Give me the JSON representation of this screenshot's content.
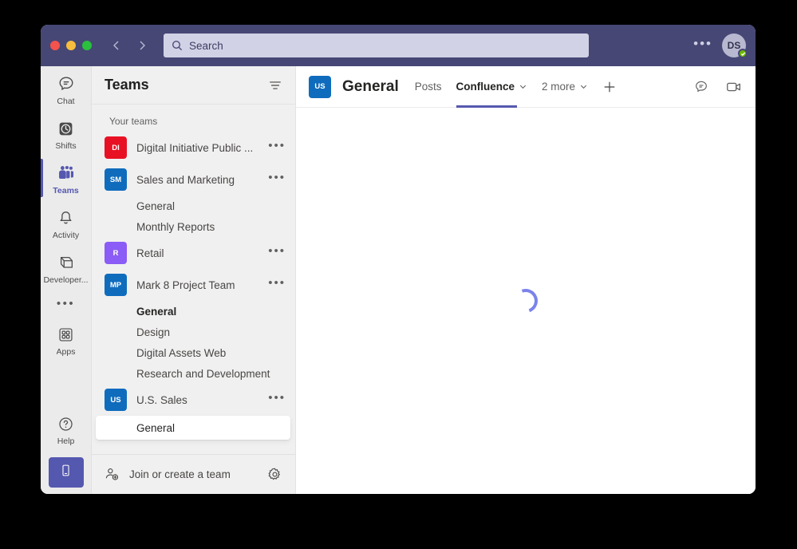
{
  "window": {
    "traffic_lights": [
      "close",
      "minimize",
      "maximize"
    ]
  },
  "titlebar": {
    "back_icon": "chevron-left-icon",
    "forward_icon": "chevron-right-icon",
    "search": {
      "icon": "search-icon",
      "placeholder": "Search",
      "value": ""
    },
    "overflow_label": "•••",
    "avatar": {
      "initials": "DS",
      "presence": "available"
    }
  },
  "rail": {
    "items": [
      {
        "label": "Chat",
        "icon": "chat-icon",
        "active": false
      },
      {
        "label": "Shifts",
        "icon": "shifts-icon",
        "active": false
      },
      {
        "label": "Teams",
        "icon": "teams-icon",
        "active": true
      },
      {
        "label": "Activity",
        "icon": "activity-bell-icon",
        "active": false
      },
      {
        "label": "Developer...",
        "icon": "developer-icon",
        "active": false
      }
    ],
    "more_label": "•••",
    "apps": {
      "label": "Apps",
      "icon": "apps-grid-icon"
    },
    "help": {
      "label": "Help",
      "icon": "help-question-icon"
    },
    "mobile_button": {
      "icon": "mobile-phone-icon"
    }
  },
  "teams_panel": {
    "title": "Teams",
    "filter_icon": "filter-icon",
    "section_label": "Your teams",
    "teams": [
      {
        "name": "Digital Initiative Public ...",
        "initials": "DI",
        "color": "#e81123",
        "menu": "•••",
        "channels": []
      },
      {
        "name": "Sales and Marketing",
        "initials": "SM",
        "color": "#0f6cbd",
        "menu": "•••",
        "channels": [
          {
            "name": "General",
            "bold": false,
            "selected": false
          },
          {
            "name": "Monthly Reports",
            "bold": false,
            "selected": false
          }
        ]
      },
      {
        "name": "Retail",
        "initials": "R",
        "color": "#8b5cf6",
        "menu": "•••",
        "channels": []
      },
      {
        "name": "Mark 8 Project Team",
        "initials": "MP",
        "color": "#0f6cbd",
        "menu": "•••",
        "channels": [
          {
            "name": "General",
            "bold": true,
            "selected": false
          },
          {
            "name": "Design",
            "bold": false,
            "selected": false
          },
          {
            "name": "Digital Assets Web",
            "bold": false,
            "selected": false
          },
          {
            "name": "Research and Development",
            "bold": false,
            "selected": false
          }
        ]
      },
      {
        "name": "U.S. Sales",
        "initials": "US",
        "color": "#0f6cbd",
        "menu": "•••",
        "channels": [
          {
            "name": "General",
            "bold": false,
            "selected": true
          }
        ]
      }
    ],
    "footer": {
      "icon": "add-person-icon",
      "label": "Join or create a team",
      "settings_icon": "gear-icon"
    }
  },
  "main": {
    "channel_avatar_initials": "US",
    "channel_avatar_color": "#0f6cbd",
    "channel_title": "General",
    "tabs": [
      {
        "label": "Posts",
        "active": false,
        "has_chevron": false
      },
      {
        "label": "Confluence",
        "active": true,
        "has_chevron": true
      },
      {
        "label": "2 more",
        "active": false,
        "has_chevron": true
      }
    ],
    "add_tab_icon": "plus-icon",
    "actions": [
      {
        "icon": "chat-bubble-icon"
      },
      {
        "icon": "video-camera-icon"
      }
    ],
    "content_state": "loading",
    "spinner_color": "#7b83eb"
  },
  "colors": {
    "titlebar": "#464775",
    "accent": "#5558af",
    "rail_bg": "#ebebeb",
    "panel_bg": "#f0f0f0"
  }
}
